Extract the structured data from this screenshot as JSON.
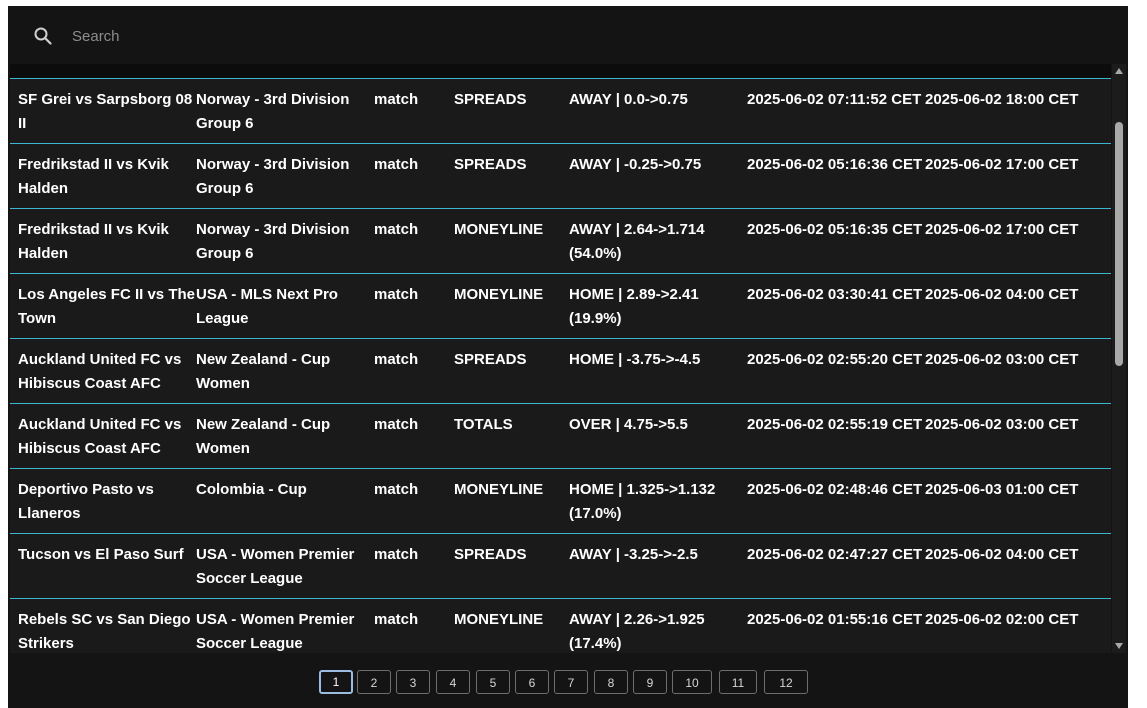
{
  "search": {
    "placeholder": "Search",
    "value": ""
  },
  "rows": [
    {
      "match": "SF Grei vs Sarpsborg 08 II",
      "league": "Norway - 3rd Division Group 6",
      "type": "match",
      "market": "SPREADS",
      "change": "AWAY | 0.0->0.75",
      "detected": "2025-06-02 07:11:52 CET",
      "kickoff": "2025-06-02 18:00 CET"
    },
    {
      "match": "Fredrikstad II vs Kvik Halden",
      "league": "Norway - 3rd Division Group 6",
      "type": "match",
      "market": "SPREADS",
      "change": "AWAY | -0.25->0.75",
      "detected": "2025-06-02 05:16:36 CET",
      "kickoff": "2025-06-02 17:00 CET"
    },
    {
      "match": "Fredrikstad II vs Kvik Halden",
      "league": "Norway - 3rd Division Group 6",
      "type": "match",
      "market": "MONEYLINE",
      "change": "AWAY | 2.64->1.714 (54.0%)",
      "detected": "2025-06-02 05:16:35 CET",
      "kickoff": "2025-06-02 17:00 CET"
    },
    {
      "match": "Los Angeles FC II vs The Town",
      "league": "USA - MLS Next Pro League",
      "type": "match",
      "market": "MONEYLINE",
      "change": "HOME | 2.89->2.41 (19.9%)",
      "detected": "2025-06-02 03:30:41 CET",
      "kickoff": "2025-06-02 04:00 CET"
    },
    {
      "match": "Auckland United FC vs Hibiscus Coast AFC",
      "league": "New Zealand - Cup Women",
      "type": "match",
      "market": "SPREADS",
      "change": "HOME | -3.75->-4.5",
      "detected": "2025-06-02 02:55:20 CET",
      "kickoff": "2025-06-02 03:00 CET"
    },
    {
      "match": "Auckland United FC vs Hibiscus Coast AFC",
      "league": "New Zealand - Cup Women",
      "type": "match",
      "market": "TOTALS",
      "change": "OVER | 4.75->5.5",
      "detected": "2025-06-02 02:55:19 CET",
      "kickoff": "2025-06-02 03:00 CET"
    },
    {
      "match": "Deportivo Pasto vs Llaneros",
      "league": "Colombia - Cup",
      "type": "match",
      "market": "MONEYLINE",
      "change": "HOME | 1.325->1.132 (17.0%)",
      "detected": "2025-06-02 02:48:46 CET",
      "kickoff": "2025-06-03 01:00 CET"
    },
    {
      "match": "Tucson vs El Paso Surf",
      "league": "USA - Women Premier Soccer League",
      "type": "match",
      "market": "SPREADS",
      "change": "AWAY | -3.25->-2.5",
      "detected": "2025-06-02 02:47:27 CET",
      "kickoff": "2025-06-02 04:00 CET"
    },
    {
      "match": "Rebels SC vs San Diego Strikers",
      "league": "USA - Women Premier Soccer League",
      "type": "match",
      "market": "MONEYLINE",
      "change": "AWAY | 2.26->1.925 (17.4%)",
      "detected": "2025-06-02 01:55:16 CET",
      "kickoff": "2025-06-02 02:00 CET"
    }
  ],
  "pagination": {
    "pages": [
      "1",
      "2",
      "3",
      "4",
      "5",
      "6",
      "7",
      "8",
      "9",
      "10",
      "11",
      "12"
    ],
    "current": "1"
  },
  "colors": {
    "background": "#141414",
    "row_border": "#3bb7d2",
    "active_page_border": "#9bbbe0"
  },
  "icons": {
    "search": "search-icon"
  }
}
